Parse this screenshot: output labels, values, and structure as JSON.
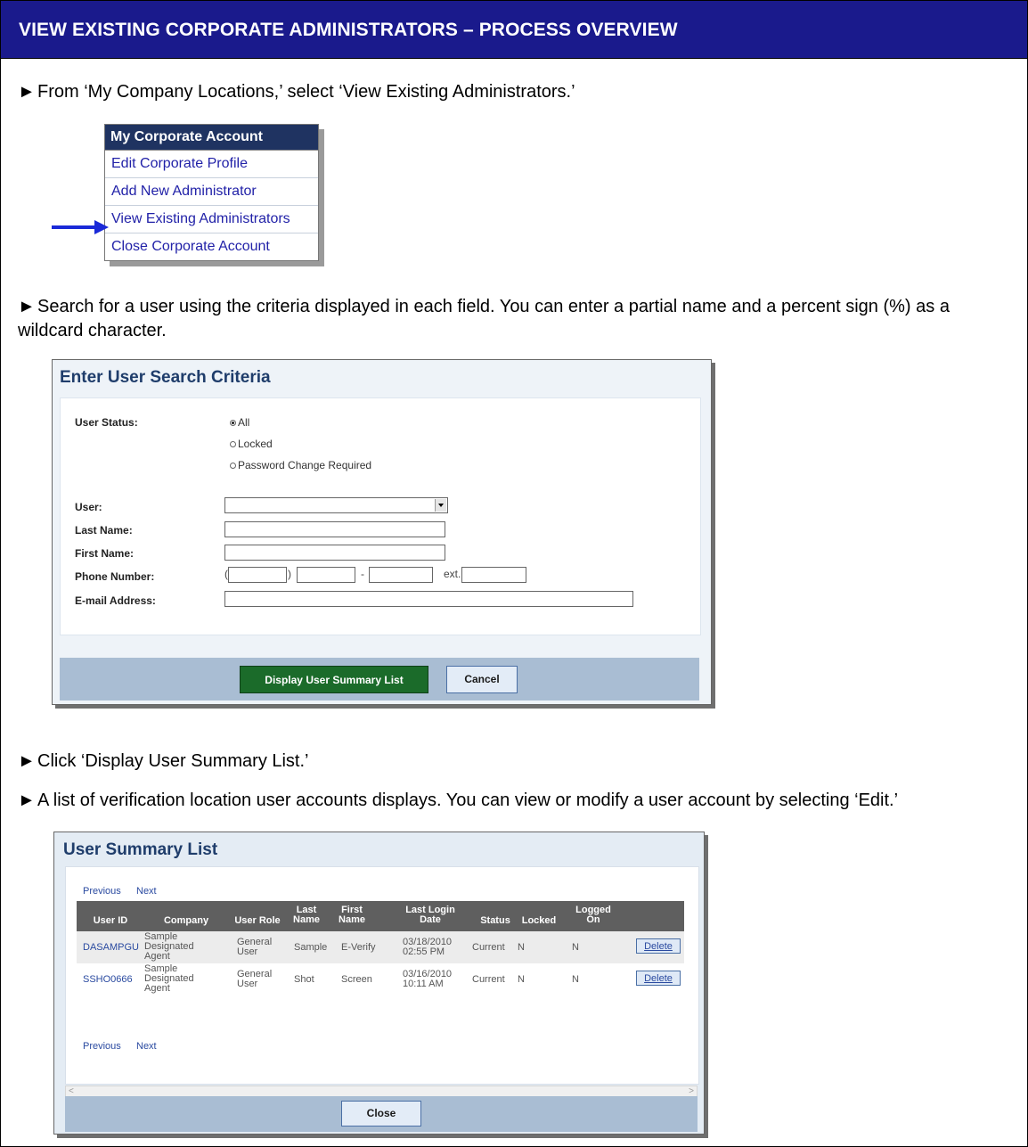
{
  "header": {
    "title": "VIEW EXISTING CORPORATE ADMINISTRATORS – PROCESS OVERVIEW"
  },
  "steps": [
    "From ‘My Company Locations,’ select ‘View Existing Administrators.’",
    "Search for a user using the criteria displayed in each field. You can enter a partial name and a percent sign (%) as a wildcard character.",
    "Click ‘Display User Summary List.’",
    "A list of verification location user accounts displays. You can view or modify a user account by selecting ‘Edit.’"
  ],
  "step_marker": "►",
  "menu": {
    "header": "My Corporate Account",
    "items": [
      "Edit Corporate Profile",
      "Add New Administrator",
      "View Existing Administrators",
      "Close Corporate Account"
    ]
  },
  "search": {
    "title": "Enter User Search Criteria",
    "labels": {
      "user_status": "User Status:",
      "user": "User:",
      "last_name": "Last Name:",
      "first_name": "First Name:",
      "phone": "Phone Number:",
      "email": "E-mail Address:"
    },
    "status_options": [
      "All",
      "Locked",
      "Password Change Required"
    ],
    "selected_status": "All",
    "phone_sep": {
      "open": "(",
      "close": ")",
      "dash": "-",
      "ext": "ext."
    },
    "buttons": {
      "display": "Display User Summary List",
      "cancel": "Cancel"
    }
  },
  "summary": {
    "title": "User Summary List",
    "pager": {
      "previous": "Previous",
      "next": "Next"
    },
    "columns": [
      "User ID",
      "Company",
      "User Role",
      "Last Name",
      "First Name",
      "Last Login Date",
      "Status",
      "Locked",
      "Logged On"
    ],
    "rows": [
      {
        "user_id": "DASAMPGU",
        "company": "Sample Designated Agent",
        "role": "General User",
        "last": "Sample",
        "first": "E-Verify",
        "login": "03/18/2010 02:55 PM",
        "status": "Current",
        "locked": "N",
        "logged": "N",
        "action": "Delete"
      },
      {
        "user_id": "SSHO0666",
        "company": "Sample Designated Agent",
        "role": "General User",
        "last": "Shot",
        "first": "Screen",
        "login": "03/16/2010 10:11 AM",
        "status": "Current",
        "locked": "N",
        "logged": "N",
        "action": "Delete"
      }
    ],
    "close": "Close",
    "scroll_left": "<",
    "scroll_right": ">"
  }
}
